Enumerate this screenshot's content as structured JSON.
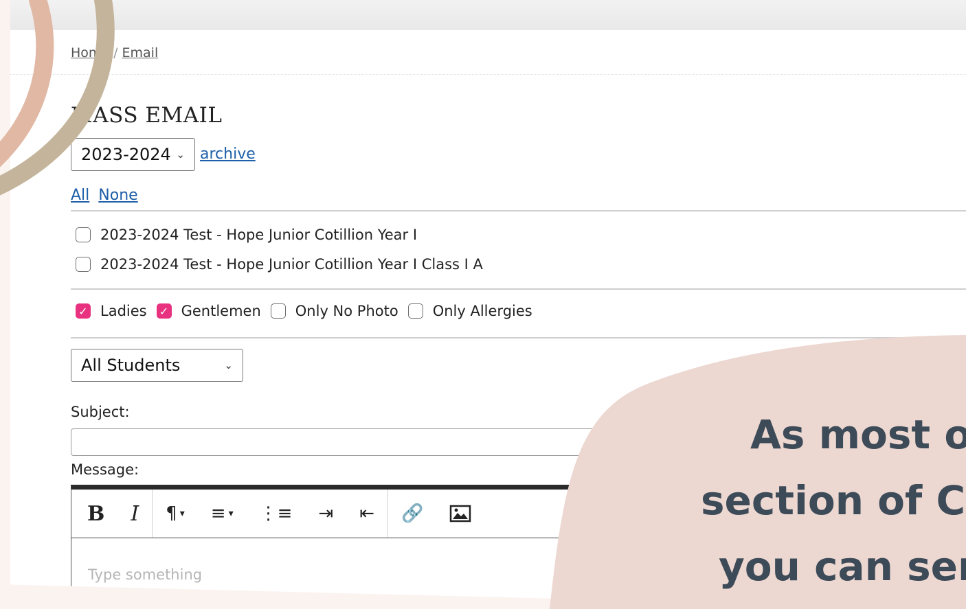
{
  "breadcrumb": {
    "home": "Home",
    "current": "Email",
    "separator": "/"
  },
  "page": {
    "title": "MASS EMAIL"
  },
  "season_select": {
    "value": "2023-2024",
    "archive_link": "archive"
  },
  "selection_links": {
    "all": "All",
    "none": "None"
  },
  "classes": [
    {
      "label": "2023-2024 Test - Hope Junior Cotillion Year I",
      "checked": false
    },
    {
      "label": "2023-2024 Test - Hope Junior Cotillion Year I Class I A",
      "checked": false
    }
  ],
  "filters": [
    {
      "label": "Ladies",
      "checked": true
    },
    {
      "label": "Gentlemen",
      "checked": true
    },
    {
      "label": "Only No Photo",
      "checked": false
    },
    {
      "label": "Only Allergies",
      "checked": false
    }
  ],
  "recipient_select": {
    "value": "All Students"
  },
  "form": {
    "subject_label": "Subject:",
    "subject_value": "",
    "message_label": "Message:",
    "message_placeholder": "Type something"
  },
  "overlay": {
    "lines": [
      "As most o",
      "section of C",
      "you can ser"
    ]
  },
  "colors": {
    "accent": "#e8317f",
    "link": "#1d5fa8",
    "overlay_blob": "#ecd7d1",
    "overlay_text": "#3d4a57"
  }
}
